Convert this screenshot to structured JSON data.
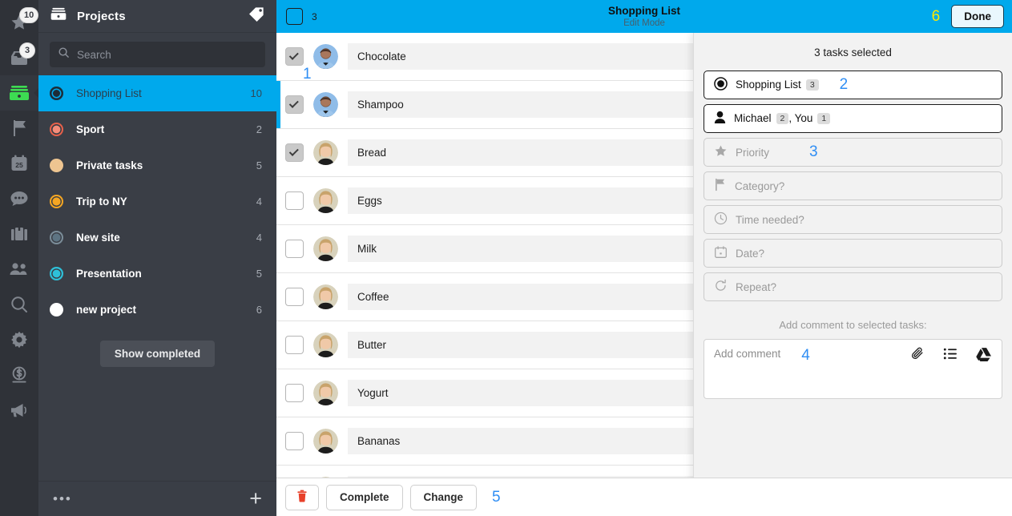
{
  "rail": {
    "items": [
      {
        "name": "star-icon",
        "badge": "10"
      },
      {
        "name": "inbox-icon",
        "badge": "3"
      },
      {
        "name": "wallet-icon",
        "badge": ""
      },
      {
        "name": "flag-icon",
        "badge": ""
      },
      {
        "name": "calendar-icon",
        "badge": "",
        "day": "25"
      },
      {
        "name": "chat-icon",
        "badge": ""
      },
      {
        "name": "briefcase-icon",
        "badge": ""
      },
      {
        "name": "people-icon",
        "badge": ""
      },
      {
        "name": "search-icon",
        "badge": ""
      },
      {
        "name": "gear-icon",
        "badge": ""
      },
      {
        "name": "dollar-icon",
        "badge": ""
      },
      {
        "name": "megaphone-icon",
        "badge": ""
      }
    ]
  },
  "sidebar": {
    "title": "Projects",
    "tag_icon": "tag-icon",
    "search": {
      "placeholder": "Search",
      "value": ""
    },
    "projects": [
      {
        "label": "Shopping List",
        "count": "10",
        "color": "#1d2d38",
        "ring": "#1d2d38",
        "style": "ring",
        "selected": true
      },
      {
        "label": "Sport",
        "count": "2",
        "color": "#f58d7a",
        "ring": "#e8604a",
        "style": "ring"
      },
      {
        "label": "Private tasks",
        "count": "5",
        "color": "#eec591",
        "ring": "#eec591",
        "style": "solid"
      },
      {
        "label": "Trip to NY",
        "count": "4",
        "color": "#f5a623",
        "ring": "#f5a623",
        "style": "ring"
      },
      {
        "label": "New site",
        "count": "4",
        "color": "#5d7483",
        "ring": "#7b8d99",
        "style": "ring"
      },
      {
        "label": "Presentation",
        "count": "5",
        "color": "#2ec0d9",
        "ring": "#2ec0d9",
        "style": "ring"
      },
      {
        "label": "new project",
        "count": "6",
        "color": "#ffffff",
        "ring": "#ffffff",
        "style": "solid"
      }
    ],
    "show_completed_label": "Show completed",
    "footer": {
      "more_label": "•••",
      "add_label": "+"
    }
  },
  "topbar": {
    "selected_count": "3",
    "title": "Shopping List",
    "subtitle": "Edit Mode",
    "annotation": "6",
    "done_label": "Done",
    "accent_color": "#00a9ec"
  },
  "tasks": [
    {
      "title": "Chocolate",
      "checked": true,
      "avatar": "male",
      "annotation": "1"
    },
    {
      "title": "Shampoo",
      "checked": true,
      "avatar": "male",
      "selbar": true
    },
    {
      "title": "Bread",
      "checked": true,
      "avatar": "female"
    },
    {
      "title": "Eggs",
      "checked": false,
      "avatar": "female"
    },
    {
      "title": "Milk",
      "checked": false,
      "avatar": "female"
    },
    {
      "title": "Coffee",
      "checked": false,
      "avatar": "female"
    },
    {
      "title": "Butter",
      "checked": false,
      "avatar": "female"
    },
    {
      "title": "Yogurt",
      "checked": false,
      "avatar": "female"
    },
    {
      "title": "Bananas",
      "checked": false,
      "avatar": "female"
    },
    {
      "title": "",
      "checked": false,
      "avatar": "female"
    }
  ],
  "bottombar": {
    "delete_icon": "trash-icon",
    "complete_label": "Complete",
    "change_label": "Change",
    "annotation": "5"
  },
  "panel": {
    "heading": "3 tasks selected",
    "project_field": {
      "icon": "radio-target-icon",
      "label": "Shopping List",
      "badge": "3",
      "annotation": "2"
    },
    "assignee_field": {
      "icon": "person-icon",
      "label": "Michael",
      "badge": "2",
      "label2": ", You",
      "badge2": "1"
    },
    "priority_field": {
      "icon": "star-icon",
      "label": "Priority",
      "annotation": "3"
    },
    "category_field": {
      "icon": "flag-icon",
      "label": "Category?"
    },
    "time_field": {
      "icon": "clock-icon",
      "label": "Time needed?"
    },
    "date_field": {
      "icon": "calendar-icon",
      "label": "Date?"
    },
    "repeat_field": {
      "icon": "repeat-icon",
      "label": "Repeat?"
    },
    "comment_caption": "Add comment to selected tasks:",
    "comment_placeholder": "Add comment",
    "comment_annotation": "4",
    "comment_icons": [
      "paperclip-icon",
      "checklist-icon",
      "google-drive-icon"
    ],
    "footer_glyph": "→|"
  }
}
